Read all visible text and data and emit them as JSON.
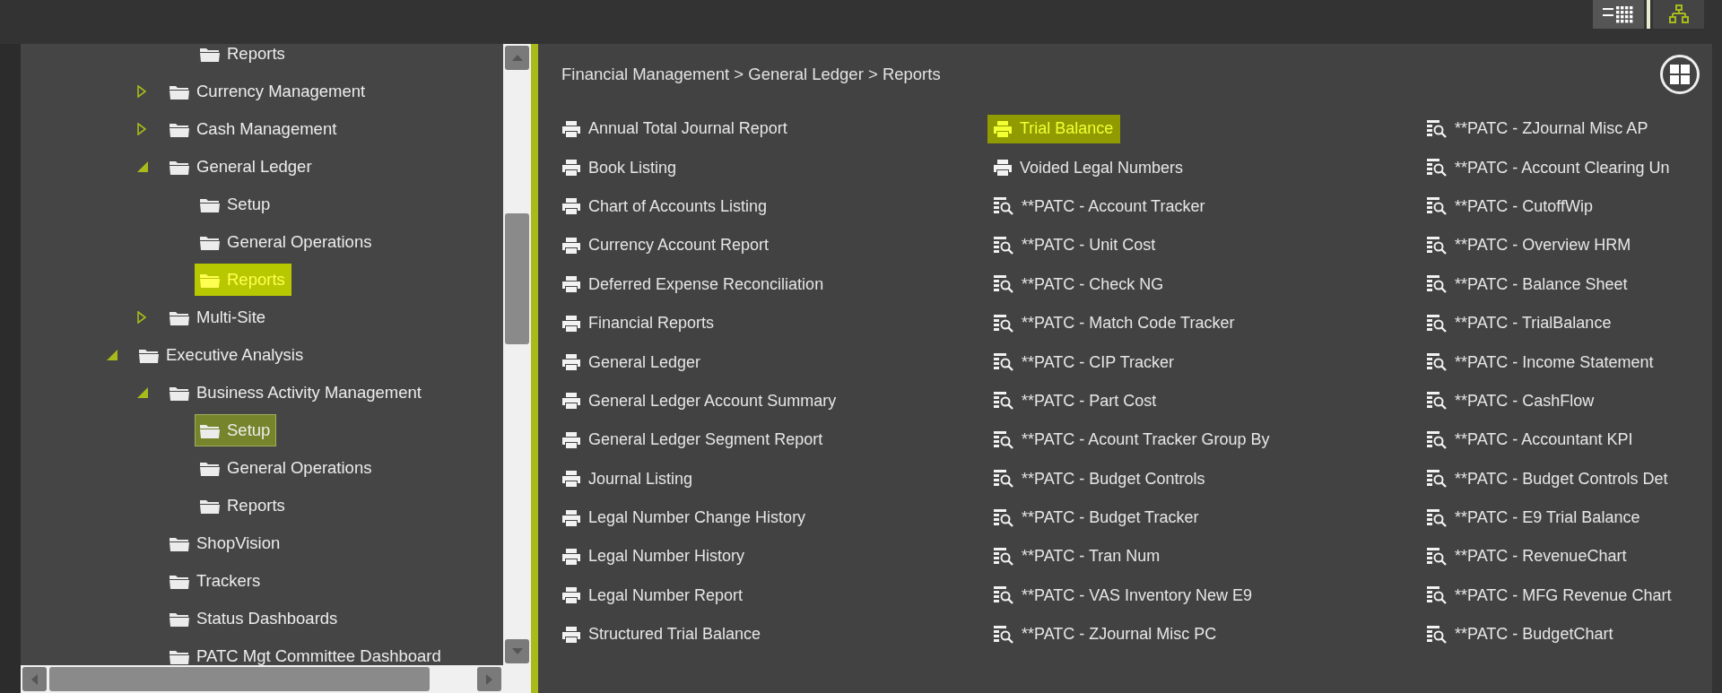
{
  "toolbar": {
    "buttons": [
      {
        "kind": "list",
        "selected": false
      },
      {
        "kind": "tree",
        "selected": true
      }
    ]
  },
  "tree": [
    {
      "children": [
        {
          "children": [
            {
              "label": "Reports",
              "expandable": false,
              "selected": false,
              "highlighted": false
            }
          ]
        },
        {
          "label": "Currency Management",
          "expandable": true,
          "expanded": false,
          "selected": false,
          "highlighted": false
        },
        {
          "label": "Cash Management",
          "expandable": true,
          "expanded": false,
          "selected": false,
          "highlighted": false
        },
        {
          "label": "General Ledger",
          "expandable": true,
          "expanded": true,
          "selected": false,
          "highlighted": false,
          "children": [
            {
              "label": "Setup",
              "expandable": false,
              "selected": false,
              "highlighted": false
            },
            {
              "label": "General Operations",
              "expandable": false,
              "selected": false,
              "highlighted": false
            },
            {
              "label": "Reports",
              "expandable": false,
              "selected": false,
              "highlighted": true
            }
          ]
        },
        {
          "label": "Multi-Site",
          "expandable": true,
          "expanded": false,
          "selected": false,
          "highlighted": false
        }
      ]
    },
    {
      "label": "Executive Analysis",
      "expandable": true,
      "expanded": true,
      "selected": false,
      "highlighted": false,
      "children": [
        {
          "label": "Business Activity Management",
          "expandable": true,
          "expanded": true,
          "selected": false,
          "highlighted": false,
          "children": [
            {
              "label": "Setup",
              "expandable": false,
              "selected": true,
              "highlighted": false
            },
            {
              "label": "General Operations",
              "expandable": false,
              "selected": false,
              "highlighted": false
            },
            {
              "label": "Reports",
              "expandable": false,
              "selected": false,
              "highlighted": false
            }
          ]
        },
        {
          "label": "ShopVision",
          "expandable": false,
          "selected": false,
          "highlighted": false
        },
        {
          "label": "Trackers",
          "expandable": false,
          "selected": false,
          "highlighted": false
        },
        {
          "label": "Status Dashboards",
          "expandable": false,
          "selected": false,
          "highlighted": false
        },
        {
          "label": "PATC Mgt Committee Dashboard",
          "expandable": false,
          "selected": false,
          "highlighted": false
        }
      ]
    }
  ],
  "breadcrumb": "Financial Management > General Ledger > Reports",
  "report_columns": [
    [
      {
        "label": "Annual Total Journal Report",
        "kind": "print",
        "highlighted": false
      },
      {
        "label": "Book Listing",
        "kind": "print",
        "highlighted": false
      },
      {
        "label": "Chart of Accounts Listing",
        "kind": "print",
        "highlighted": false
      },
      {
        "label": "Currency Account Report",
        "kind": "print",
        "highlighted": false
      },
      {
        "label": "Deferred Expense Reconciliation",
        "kind": "print",
        "highlighted": false
      },
      {
        "label": "Financial Reports",
        "kind": "print",
        "highlighted": false
      },
      {
        "label": "General Ledger",
        "kind": "print",
        "highlighted": false
      },
      {
        "label": "General Ledger Account Summary",
        "kind": "print",
        "highlighted": false
      },
      {
        "label": "General Ledger Segment Report",
        "kind": "print",
        "highlighted": false
      },
      {
        "label": "Journal Listing",
        "kind": "print",
        "highlighted": false
      },
      {
        "label": "Legal Number Change History",
        "kind": "print",
        "highlighted": false
      },
      {
        "label": "Legal Number History",
        "kind": "print",
        "highlighted": false
      },
      {
        "label": "Legal Number Report",
        "kind": "print",
        "highlighted": false
      },
      {
        "label": "Structured Trial Balance",
        "kind": "print",
        "highlighted": false
      }
    ],
    [
      {
        "label": "Trial Balance",
        "kind": "print",
        "highlighted": true
      },
      {
        "label": "Voided Legal Numbers",
        "kind": "print",
        "highlighted": false
      },
      {
        "label": "**PATC - Account Tracker",
        "kind": "query",
        "highlighted": false
      },
      {
        "label": "**PATC - Unit Cost",
        "kind": "query",
        "highlighted": false
      },
      {
        "label": "**PATC - Check NG",
        "kind": "query",
        "highlighted": false
      },
      {
        "label": "**PATC - Match Code Tracker",
        "kind": "query",
        "highlighted": false
      },
      {
        "label": "**PATC - CIP Tracker",
        "kind": "query",
        "highlighted": false
      },
      {
        "label": "**PATC - Part Cost",
        "kind": "query",
        "highlighted": false
      },
      {
        "label": "**PATC - Acount Tracker Group By",
        "kind": "query",
        "highlighted": false
      },
      {
        "label": "**PATC - Budget Controls",
        "kind": "query",
        "highlighted": false
      },
      {
        "label": "**PATC - Budget Tracker",
        "kind": "query",
        "highlighted": false
      },
      {
        "label": "**PATC - Tran Num",
        "kind": "query",
        "highlighted": false
      },
      {
        "label": "**PATC - VAS Inventory New E9",
        "kind": "query",
        "highlighted": false
      },
      {
        "label": "**PATC - ZJournal Misc PC",
        "kind": "query",
        "highlighted": false
      }
    ],
    [
      {
        "label": "**PATC - ZJournal Misc AP",
        "kind": "query",
        "highlighted": false
      },
      {
        "label": "**PATC - Account Clearing Un",
        "kind": "query",
        "highlighted": false
      },
      {
        "label": "**PATC - CutoffWip",
        "kind": "query",
        "highlighted": false
      },
      {
        "label": "**PATC - Overview HRM",
        "kind": "query",
        "highlighted": false
      },
      {
        "label": "**PATC - Balance Sheet",
        "kind": "query",
        "highlighted": false
      },
      {
        "label": "**PATC - TrialBalance",
        "kind": "query",
        "highlighted": false
      },
      {
        "label": "**PATC - Income Statement",
        "kind": "query",
        "highlighted": false
      },
      {
        "label": "**PATC - CashFlow",
        "kind": "query",
        "highlighted": false
      },
      {
        "label": "**PATC - Accountant KPI",
        "kind": "query",
        "highlighted": false
      },
      {
        "label": "**PATC - Budget Controls Det",
        "kind": "query",
        "highlighted": false
      },
      {
        "label": "**PATC - E9 Trial Balance",
        "kind": "query",
        "highlighted": false
      },
      {
        "label": "**PATC - RevenueChart",
        "kind": "query",
        "highlighted": false
      },
      {
        "label": "**PATC - MFG Revenue Chart",
        "kind": "query",
        "highlighted": false
      },
      {
        "label": "**PATC - BudgetChart",
        "kind": "query",
        "highlighted": false
      }
    ]
  ]
}
